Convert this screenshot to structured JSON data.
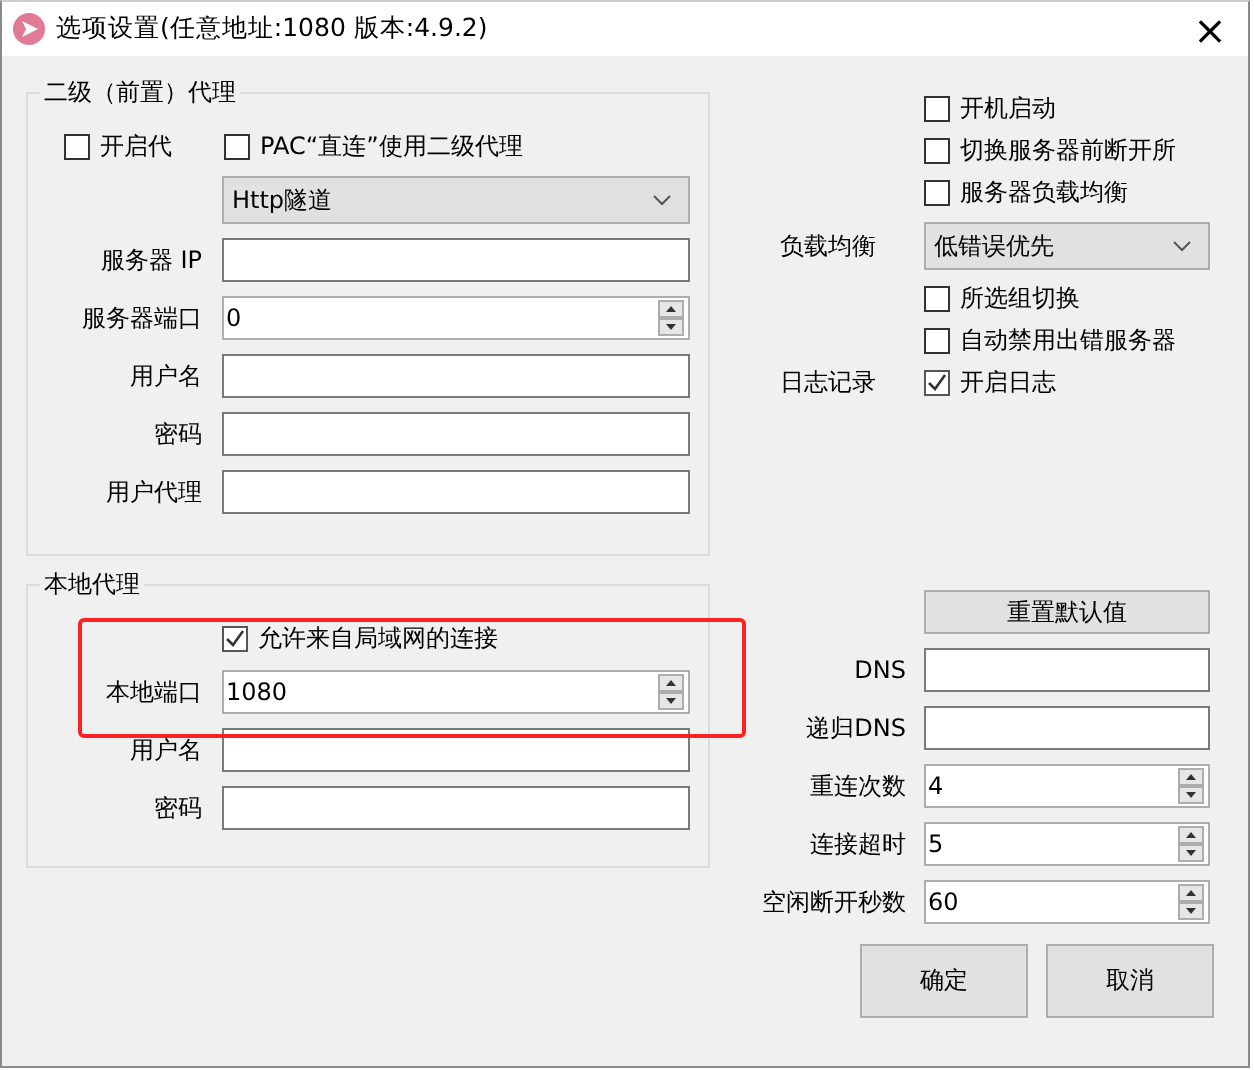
{
  "window": {
    "title": "选项设置(任意地址:1080 版本:4.9.2)",
    "close": "×"
  },
  "upstream_proxy": {
    "title": "二级（前置）代理",
    "options": [
      {
        "label": "开启代",
        "checked": false
      },
      {
        "label": "PAC“直连”使用二级代理",
        "checked": false
      }
    ],
    "protocol": {
      "value": "Http隧道"
    },
    "fields": [
      {
        "label": "服务器 IP",
        "kind": "text"
      },
      {
        "label": "服务器端口",
        "kind": "spin",
        "value": "0"
      },
      {
        "label": "用户名",
        "kind": "text"
      },
      {
        "label": "密码",
        "kind": "text"
      },
      {
        "label": "用户代理",
        "kind": "text"
      }
    ]
  },
  "local_proxy": {
    "title": "本地代理",
    "allow_lan": {
      "label": "允许来自局域网的连接",
      "checked": true
    },
    "fields": [
      {
        "label": "本地端口",
        "kind": "spin",
        "value": "1080"
      },
      {
        "label": "用户名",
        "kind": "text"
      },
      {
        "label": "密码",
        "kind": "text"
      }
    ]
  },
  "general": [
    {
      "kind": "checkbox",
      "label": "开机启动",
      "checked": false
    },
    {
      "kind": "checkbox",
      "label": "切换服务器前断开所",
      "checked": false
    },
    {
      "kind": "checkbox",
      "label": "服务器负载均衡",
      "checked": false
    },
    {
      "kind": "select",
      "caption": "负载均衡",
      "value": "低错误优先"
    },
    {
      "kind": "checkbox",
      "label": "所选组切换",
      "checked": false
    },
    {
      "kind": "checkbox",
      "label": "自动禁用出错服务器",
      "checked": false
    },
    {
      "kind": "checkbox",
      "caption": "日志记录",
      "label": "开启日志",
      "checked": true
    }
  ],
  "reset_button": "重置默认值",
  "network_fields": [
    {
      "label": "DNS",
      "kind": "text"
    },
    {
      "label": "递归DNS",
      "kind": "text"
    },
    {
      "label": "重连次数",
      "kind": "spin",
      "value": "4"
    },
    {
      "label": "连接超时",
      "kind": "spin",
      "value": "5"
    },
    {
      "label": "空闲断开秒数",
      "kind": "spin",
      "value": "60"
    }
  ],
  "buttons": [
    "确定",
    "取消"
  ]
}
